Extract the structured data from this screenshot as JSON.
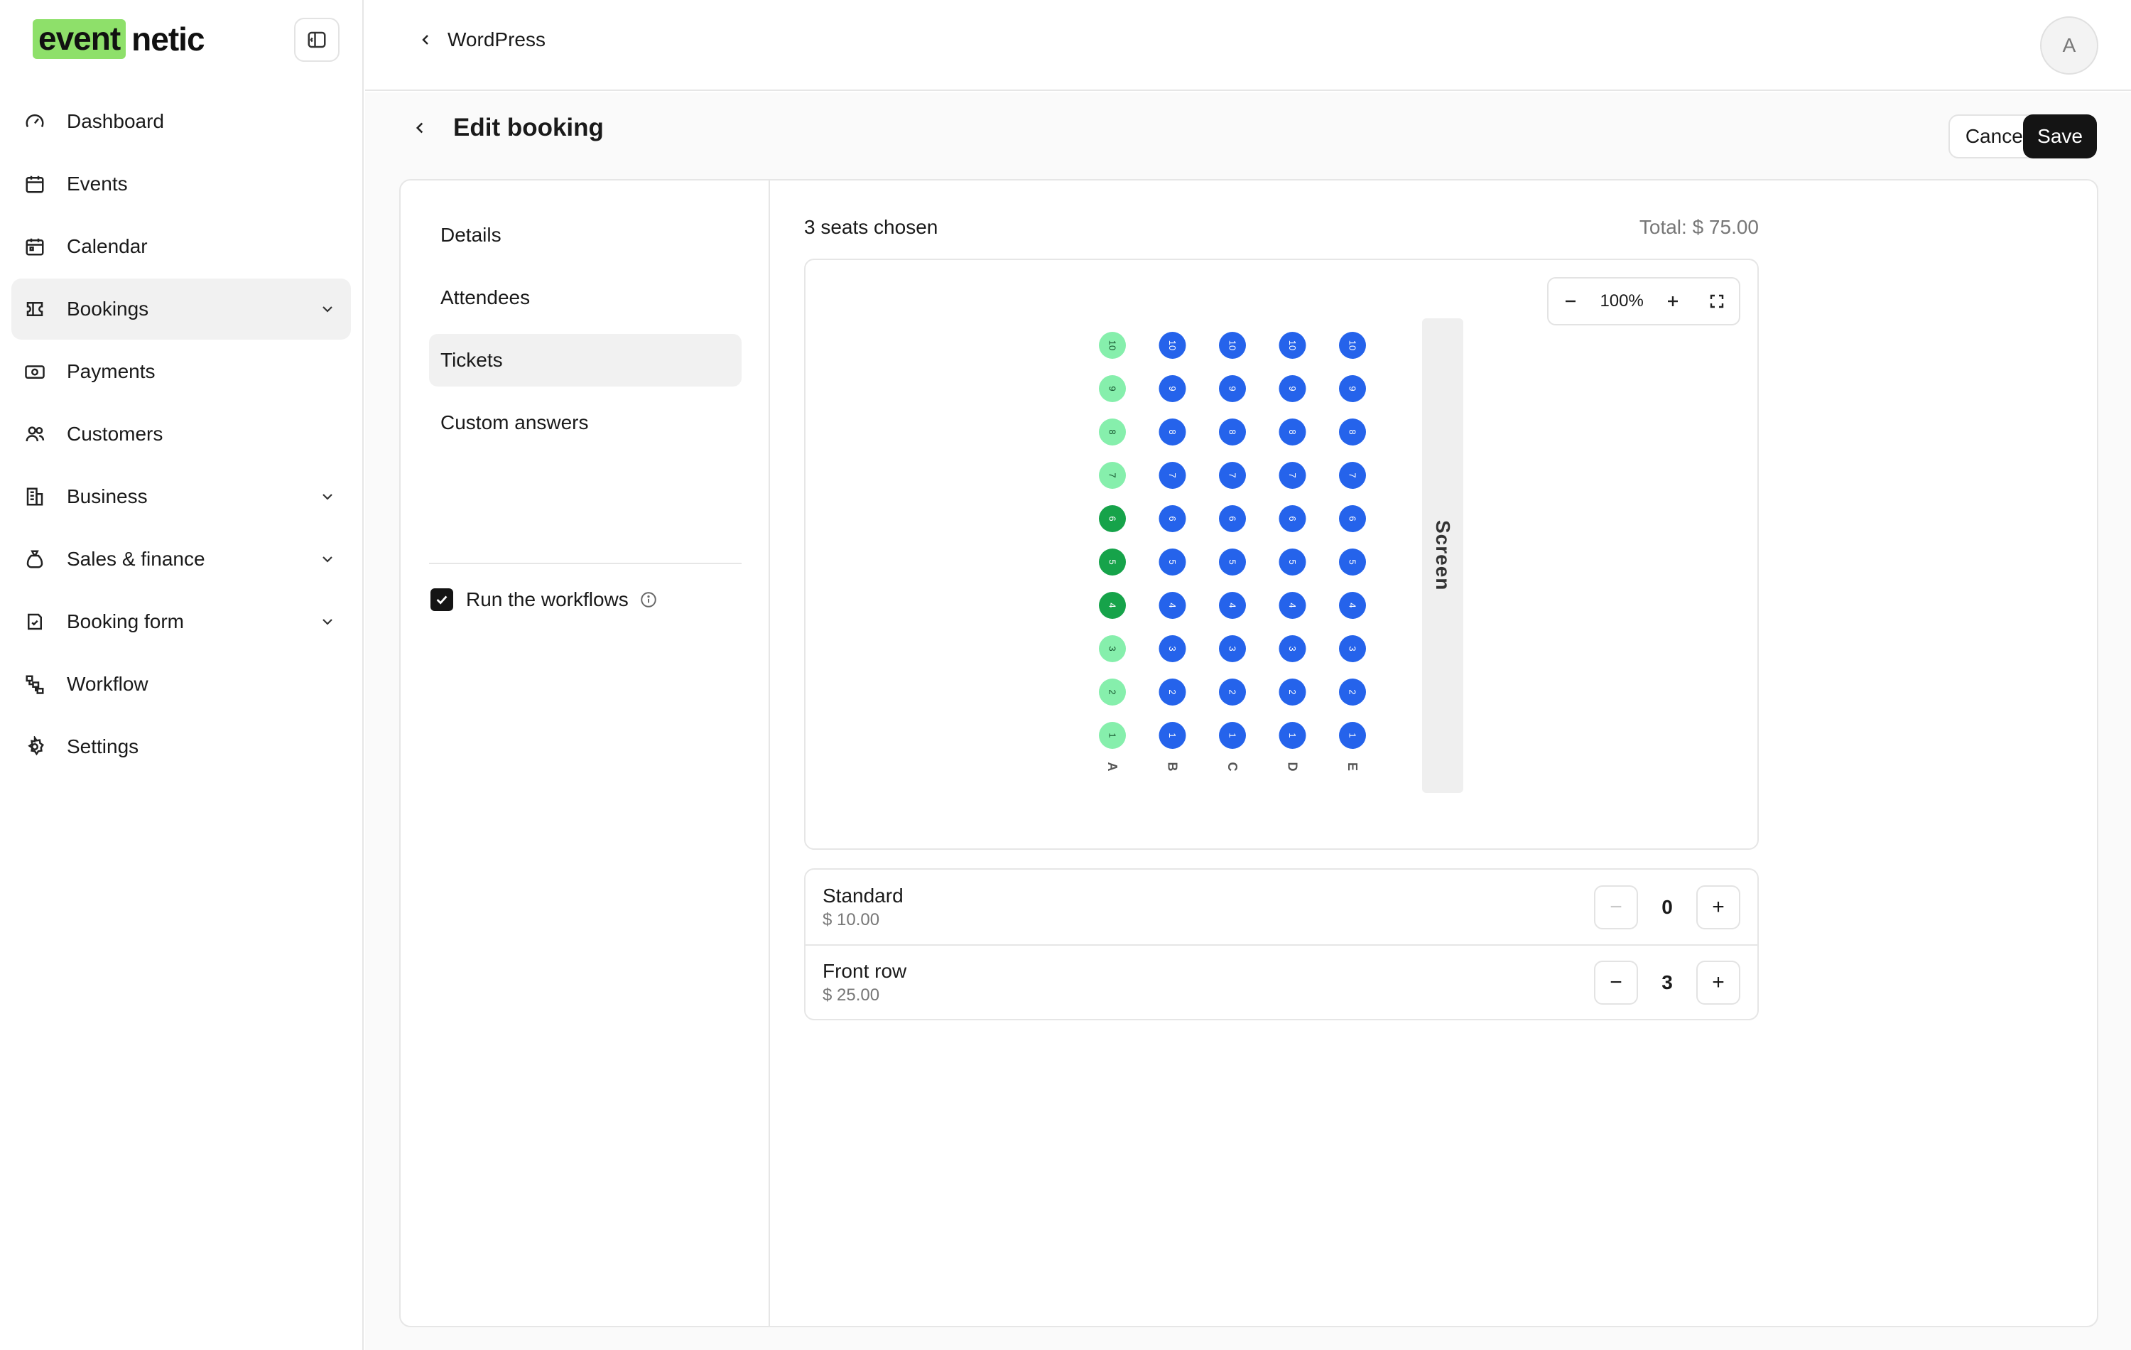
{
  "brand": {
    "part1": "event",
    "part2": "netic"
  },
  "sidebar": {
    "items": [
      {
        "label": "Dashboard",
        "icon": "dashboard-icon"
      },
      {
        "label": "Events",
        "icon": "calendar-icon"
      },
      {
        "label": "Calendar",
        "icon": "calendar-icon"
      },
      {
        "label": "Bookings",
        "icon": "ticket-icon",
        "active": true,
        "expandable": true
      },
      {
        "label": "Payments",
        "icon": "payment-icon"
      },
      {
        "label": "Customers",
        "icon": "users-icon"
      },
      {
        "label": "Business",
        "icon": "building-icon",
        "expandable": true
      },
      {
        "label": "Sales & finance",
        "icon": "money-bag-icon",
        "expandable": true
      },
      {
        "label": "Booking form",
        "icon": "form-icon",
        "expandable": true
      },
      {
        "label": "Workflow",
        "icon": "workflow-icon"
      },
      {
        "label": "Settings",
        "icon": "gear-icon"
      }
    ]
  },
  "topbar": {
    "breadcrumb": "WordPress",
    "avatar_initial": "A"
  },
  "page": {
    "title": "Edit booking",
    "cancel_label": "Cancel",
    "save_label": "Save"
  },
  "tabs": [
    {
      "label": "Details"
    },
    {
      "label": "Attendees"
    },
    {
      "label": "Tickets",
      "active": true
    },
    {
      "label": "Custom answers"
    }
  ],
  "workflow": {
    "label": "Run the workflows",
    "checked": true
  },
  "seating": {
    "chosen_text": "3 seats chosen",
    "total_text": "Total: $ 75.00",
    "zoom_text": "100%",
    "screen_label": "Screen",
    "rows": [
      "A",
      "B",
      "C",
      "D",
      "E"
    ],
    "seat_numbers": [
      10,
      9,
      8,
      7,
      6,
      5,
      4,
      3,
      2,
      1
    ],
    "seat_status": {
      "A": [
        "front",
        "front",
        "front",
        "front",
        "selected",
        "selected",
        "selected",
        "front",
        "front",
        "front"
      ],
      "B": [
        "standard",
        "standard",
        "standard",
        "standard",
        "standard",
        "standard",
        "standard",
        "standard",
        "standard",
        "standard"
      ],
      "C": [
        "standard",
        "standard",
        "standard",
        "standard",
        "standard",
        "standard",
        "standard",
        "standard",
        "standard",
        "standard"
      ],
      "D": [
        "standard",
        "standard",
        "standard",
        "standard",
        "standard",
        "standard",
        "standard",
        "standard",
        "standard",
        "standard"
      ],
      "E": [
        "standard",
        "standard",
        "standard",
        "standard",
        "standard",
        "standard",
        "standard",
        "standard",
        "standard",
        "standard"
      ]
    },
    "colors": {
      "front": "#86efac",
      "selected": "#16a34a",
      "standard": "#2563eb"
    }
  },
  "tickets": [
    {
      "name": "Standard",
      "price": "$ 10.00",
      "qty": "0",
      "minus_disabled": true
    },
    {
      "name": "Front row",
      "price": "$ 25.00",
      "qty": "3",
      "minus_disabled": false
    }
  ]
}
